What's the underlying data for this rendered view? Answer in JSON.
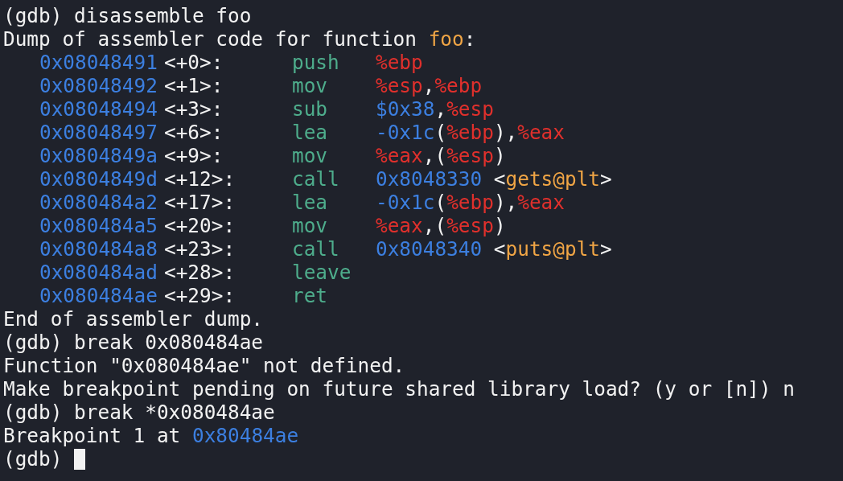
{
  "terminal": {
    "lines": [
      {
        "kind": "text",
        "parts": [
          {
            "text": "(gdb) disassemble foo",
            "kind": "plain"
          }
        ]
      },
      {
        "kind": "text",
        "parts": [
          {
            "text": "Dump of assembler code for function ",
            "kind": "plain"
          },
          {
            "text": "foo",
            "kind": "symbol"
          },
          {
            "text": ":",
            "kind": "plain"
          }
        ]
      },
      {
        "kind": "instruction",
        "address": "0x08048491",
        "offset": "<+0>:",
        "mnemonic": "push",
        "operands": [
          {
            "text": "%ebp",
            "kind": "register"
          }
        ]
      },
      {
        "kind": "instruction",
        "address": "0x08048492",
        "offset": "<+1>:",
        "mnemonic": "mov",
        "operands": [
          {
            "text": "%esp",
            "kind": "register"
          },
          {
            "text": ",",
            "kind": "plain"
          },
          {
            "text": "%ebp",
            "kind": "register"
          }
        ]
      },
      {
        "kind": "instruction",
        "address": "0x08048494",
        "offset": "<+3>:",
        "mnemonic": "sub",
        "operands": [
          {
            "text": "$0x38",
            "kind": "number"
          },
          {
            "text": ",",
            "kind": "plain"
          },
          {
            "text": "%esp",
            "kind": "register"
          }
        ]
      },
      {
        "kind": "instruction",
        "address": "0x08048497",
        "offset": "<+6>:",
        "mnemonic": "lea",
        "operands": [
          {
            "text": "-0x1c",
            "kind": "number"
          },
          {
            "text": "(",
            "kind": "plain"
          },
          {
            "text": "%ebp",
            "kind": "register"
          },
          {
            "text": "),",
            "kind": "plain"
          },
          {
            "text": "%eax",
            "kind": "register"
          }
        ]
      },
      {
        "kind": "instruction",
        "address": "0x0804849a",
        "offset": "<+9>:",
        "mnemonic": "mov",
        "operands": [
          {
            "text": "%eax",
            "kind": "register"
          },
          {
            "text": ",(",
            "kind": "plain"
          },
          {
            "text": "%esp",
            "kind": "register"
          },
          {
            "text": ")",
            "kind": "plain"
          }
        ]
      },
      {
        "kind": "instruction",
        "address": "0x0804849d",
        "offset": "<+12>:",
        "mnemonic": "call",
        "operands": [
          {
            "text": "0x8048330",
            "kind": "number"
          },
          {
            "text": " <",
            "kind": "plain"
          },
          {
            "text": "gets@plt",
            "kind": "symbol"
          },
          {
            "text": ">",
            "kind": "plain"
          }
        ]
      },
      {
        "kind": "instruction",
        "address": "0x080484a2",
        "offset": "<+17>:",
        "mnemonic": "lea",
        "operands": [
          {
            "text": "-0x1c",
            "kind": "number"
          },
          {
            "text": "(",
            "kind": "plain"
          },
          {
            "text": "%ebp",
            "kind": "register"
          },
          {
            "text": "),",
            "kind": "plain"
          },
          {
            "text": "%eax",
            "kind": "register"
          }
        ]
      },
      {
        "kind": "instruction",
        "address": "0x080484a5",
        "offset": "<+20>:",
        "mnemonic": "mov",
        "operands": [
          {
            "text": "%eax",
            "kind": "register"
          },
          {
            "text": ",(",
            "kind": "plain"
          },
          {
            "text": "%esp",
            "kind": "register"
          },
          {
            "text": ")",
            "kind": "plain"
          }
        ]
      },
      {
        "kind": "instruction",
        "address": "0x080484a8",
        "offset": "<+23>:",
        "mnemonic": "call",
        "operands": [
          {
            "text": "0x8048340",
            "kind": "number"
          },
          {
            "text": " <",
            "kind": "plain"
          },
          {
            "text": "puts@plt",
            "kind": "symbol"
          },
          {
            "text": ">",
            "kind": "plain"
          }
        ]
      },
      {
        "kind": "instruction",
        "address": "0x080484ad",
        "offset": "<+28>:",
        "mnemonic": "leave"
      },
      {
        "kind": "instruction",
        "address": "0x080484ae",
        "offset": "<+29>:",
        "mnemonic": "ret"
      },
      {
        "kind": "text",
        "parts": [
          {
            "text": "End of assembler dump.",
            "kind": "plain"
          }
        ]
      },
      {
        "kind": "text",
        "parts": [
          {
            "text": "(gdb) break 0x080484ae",
            "kind": "plain"
          }
        ]
      },
      {
        "kind": "text",
        "parts": [
          {
            "text": "Function \"0x080484ae\" not defined.",
            "kind": "plain"
          }
        ]
      },
      {
        "kind": "text",
        "parts": [
          {
            "text": "Make breakpoint pending on future shared library load? (y or [n]) n",
            "kind": "plain"
          }
        ]
      },
      {
        "kind": "text",
        "parts": [
          {
            "text": "(gdb) break *0x080484ae",
            "kind": "plain"
          }
        ]
      },
      {
        "kind": "text",
        "parts": [
          {
            "text": "Breakpoint 1 at ",
            "kind": "plain"
          },
          {
            "text": "0x80484ae",
            "kind": "number"
          }
        ]
      },
      {
        "kind": "prompt",
        "text": "(gdb)",
        "cursor": true
      }
    ]
  }
}
